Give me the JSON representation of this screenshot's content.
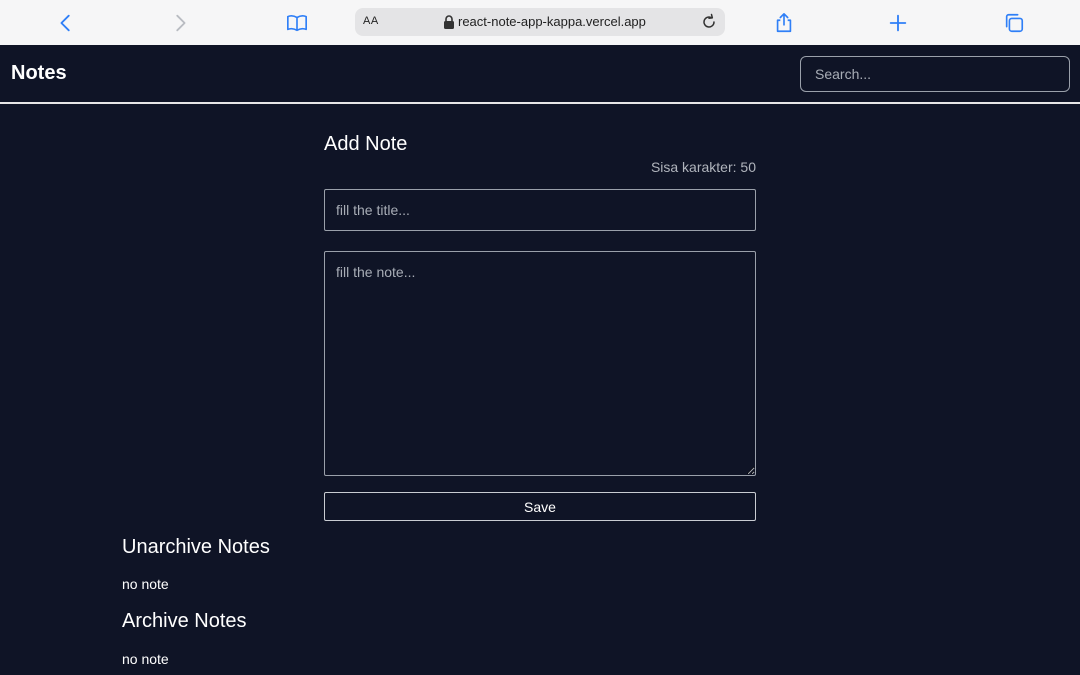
{
  "browser": {
    "aa_label": "AA",
    "url": "react-note-app-kappa.vercel.app",
    "accent": "#2f7ff7"
  },
  "header": {
    "brand": "Notes",
    "search_placeholder": "Search..."
  },
  "form": {
    "title": "Add Note",
    "char_counter": "Sisa karakter: 50",
    "title_placeholder": "fill the title...",
    "note_placeholder": "fill the note...",
    "save_label": "Save"
  },
  "sections": {
    "unarchive": {
      "heading": "Unarchive Notes",
      "empty": "no note"
    },
    "archive": {
      "heading": "Archive Notes",
      "empty": "no note"
    }
  },
  "colors": {
    "background": "#0f1426",
    "text": "#ffffff",
    "border": "#9aa0aa"
  },
  "icons": [
    "back-icon",
    "forward-icon",
    "bookmarks-icon",
    "lock-icon",
    "reload-icon",
    "share-icon",
    "new-tab-icon",
    "tabs-icon"
  ]
}
